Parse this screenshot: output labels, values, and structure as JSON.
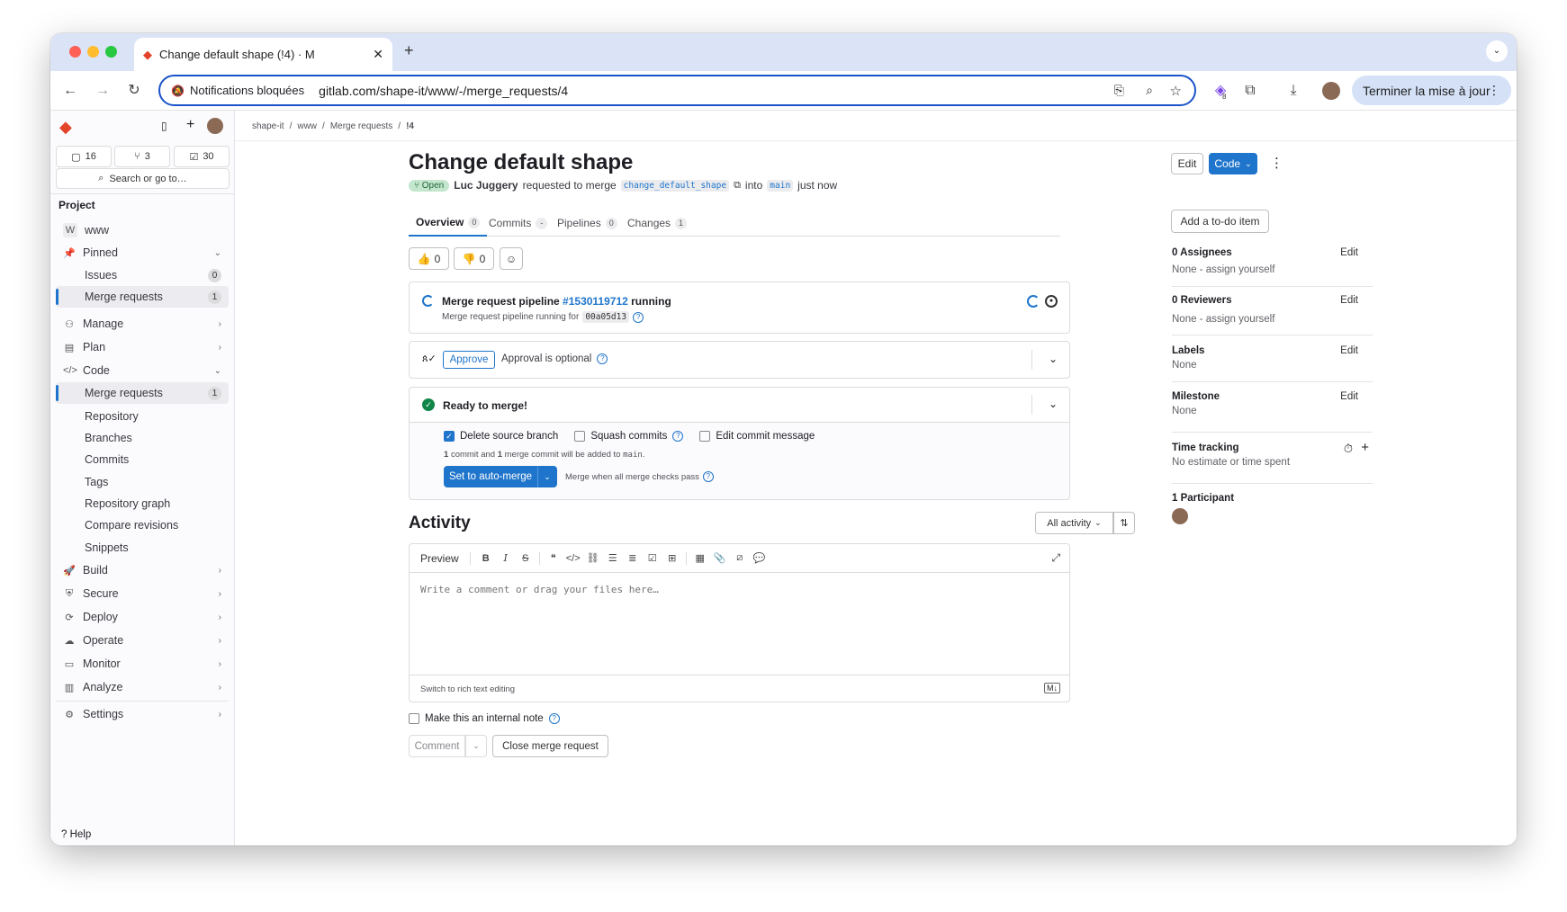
{
  "browser": {
    "tab_title": "Change default shape (!4) · M",
    "notification_label": "Notifications bloquées",
    "url": "gitlab.com/shape-it/www/-/merge_requests/4",
    "update_label": "Terminer la mise à jour",
    "extension_badge": "8"
  },
  "sidebar": {
    "counts": {
      "issues": "16",
      "mrs": "3",
      "todos": "30"
    },
    "search_label": "Search or go to…",
    "section_label": "Project",
    "project_initial": "W",
    "project_name": "www",
    "items": [
      {
        "label": "Pinned"
      },
      {
        "label": "Issues",
        "count": "0"
      },
      {
        "label": "Merge requests",
        "count": "1"
      },
      {
        "label": "Manage"
      },
      {
        "label": "Plan"
      },
      {
        "label": "Code"
      },
      {
        "label": "Merge requests",
        "count": "1"
      },
      {
        "label": "Repository"
      },
      {
        "label": "Branches"
      },
      {
        "label": "Commits"
      },
      {
        "label": "Tags"
      },
      {
        "label": "Repository graph"
      },
      {
        "label": "Compare revisions"
      },
      {
        "label": "Snippets"
      },
      {
        "label": "Build"
      },
      {
        "label": "Secure"
      },
      {
        "label": "Deploy"
      },
      {
        "label": "Operate"
      },
      {
        "label": "Monitor"
      },
      {
        "label": "Analyze"
      },
      {
        "label": "Settings"
      }
    ],
    "help_label": "Help"
  },
  "breadcrumb": [
    "shape-it",
    "/",
    "www",
    "/",
    "Merge requests",
    "/",
    "!4"
  ],
  "mr": {
    "title": "Change default shape",
    "edit_label": "Edit",
    "code_label": "Code",
    "status": "Open",
    "author": "Luc Juggery",
    "requested_text": "requested to merge",
    "source_branch": "change_default_shape",
    "into_text": "into",
    "target_branch": "main",
    "time": "just now"
  },
  "tabs": [
    {
      "label": "Overview",
      "count": "0"
    },
    {
      "label": "Commits",
      "count": "-"
    },
    {
      "label": "Pipelines",
      "count": "0"
    },
    {
      "label": "Changes",
      "count": "1"
    }
  ],
  "todo_label": "Add a to-do item",
  "reactions": {
    "up": "0",
    "down": "0"
  },
  "pipeline": {
    "title_prefix": "Merge request pipeline",
    "id": "#1530119712",
    "status": "running",
    "subtext": "Merge request pipeline running for",
    "sha": "00a05d13"
  },
  "approval": {
    "button": "Approve",
    "text": "Approval is optional"
  },
  "merge": {
    "title": "Ready to merge!",
    "delete_branch": "Delete source branch",
    "squash": "Squash commits",
    "edit_msg": "Edit commit message",
    "info_count1": "1",
    "info_mid": "commit and",
    "info_count2": "1",
    "info_tail": "merge commit will be added to",
    "info_branch": "main",
    "info_end": ".",
    "auto_merge": "Set to auto-merge",
    "checks_text": "Merge when all merge checks pass"
  },
  "activity": {
    "title": "Activity",
    "filter": "All activity",
    "preview": "Preview",
    "placeholder": "Write a comment or drag your files here…",
    "rich_text": "Switch to rich text editing",
    "internal_note": "Make this an internal note",
    "comment": "Comment",
    "close_mr": "Close merge request"
  },
  "right_sidebar": {
    "assignees": {
      "title": "0 Assignees",
      "value": "None - assign yourself"
    },
    "reviewers": {
      "title": "0 Reviewers",
      "value": "None - assign yourself"
    },
    "labels": {
      "title": "Labels",
      "value": "None"
    },
    "milestone": {
      "title": "Milestone",
      "value": "None"
    },
    "time": {
      "title": "Time tracking",
      "value": "No estimate or time spent"
    },
    "participants": {
      "title": "1 Participant"
    },
    "edit_label": "Edit"
  },
  "colors": {
    "accent": "#1f75cb",
    "success": "#108548",
    "open_badge": "#c3e6cd"
  }
}
